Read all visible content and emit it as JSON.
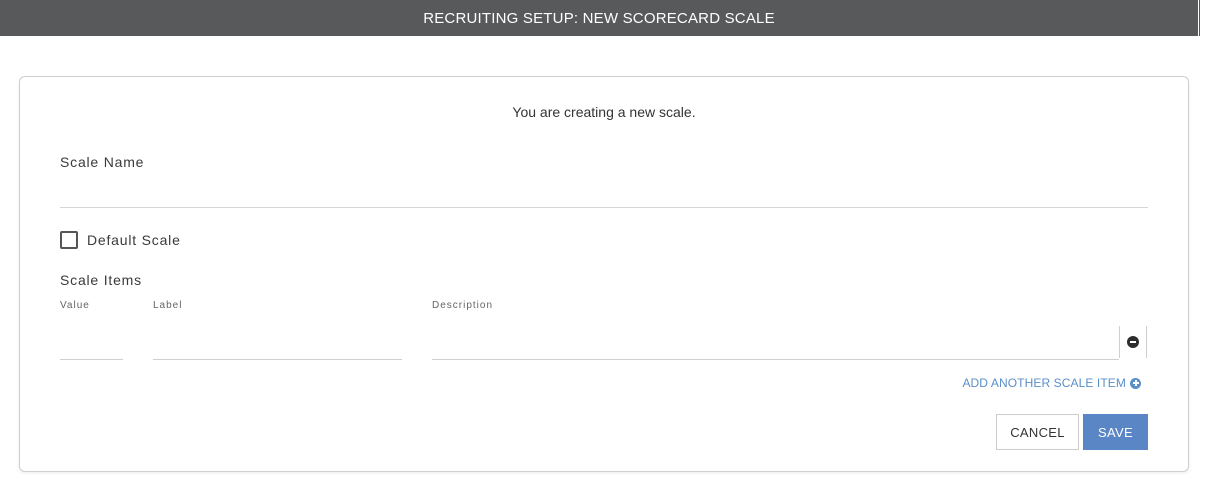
{
  "header": {
    "title": "RECRUITING SETUP: NEW SCORECARD SCALE"
  },
  "form": {
    "intro": "You are creating a new scale.",
    "scale_name_label": "Scale Name",
    "scale_name_value": "",
    "default_scale_label": "Default Scale",
    "default_scale_checked": false,
    "scale_items_label": "Scale Items",
    "columns": {
      "value": "Value",
      "label": "Label",
      "description": "Description"
    },
    "items": [
      {
        "value": "",
        "label": "",
        "description": ""
      }
    ],
    "add_item_label": "ADD ANOTHER SCALE ITEM"
  },
  "actions": {
    "cancel_label": "CANCEL",
    "save_label": "SAVE"
  },
  "icons": {
    "remove": "minus-circle-icon",
    "add": "plus-circle-icon"
  },
  "colors": {
    "header_bg": "#58595b",
    "accent": "#5b86c5",
    "link": "#5a8fc8"
  }
}
